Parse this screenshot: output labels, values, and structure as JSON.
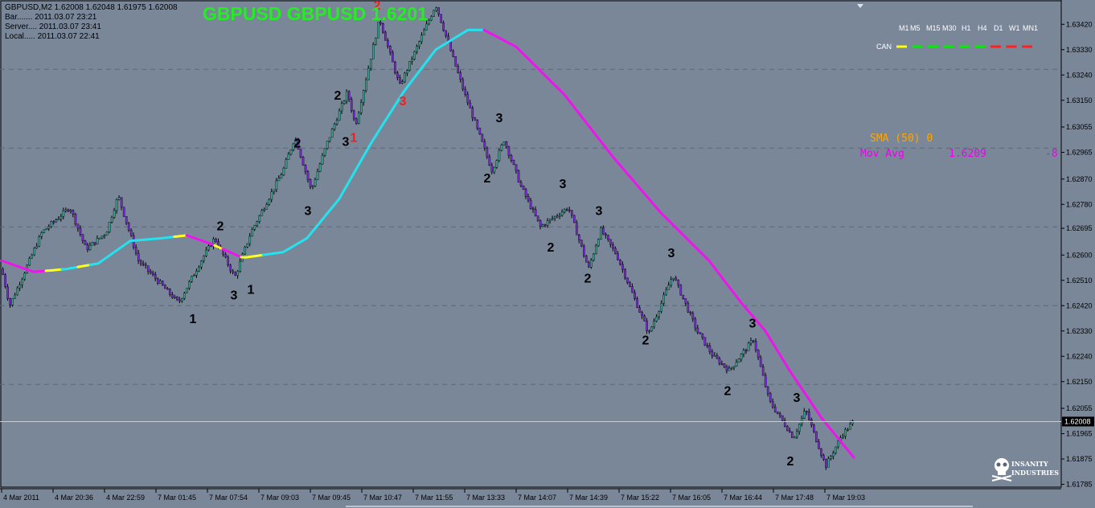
{
  "symbol_info": {
    "line1": "GBPUSD,M2  1.62008 1.62048 1.61975 1.62008",
    "line2": "Bar.......  2011.03.07 23:21",
    "line3": "Server....  2011.03.07 23:41",
    "line4": "Local.....  2011.03.07 22:41"
  },
  "chart_title": "GBPUSD GBPUSD 1.6201",
  "timeframes": [
    "M1",
    "M5",
    "M15",
    "M30",
    "H1",
    "H4",
    "D1",
    "W1",
    "MN1"
  ],
  "can_label": "CAN",
  "can_colors": [
    "#ffff00",
    "#00ee00",
    "#00ee00",
    "#00ee00",
    "#00ee00",
    "#00ee00",
    "#ff2020",
    "#ff2020",
    "#ff2020"
  ],
  "indicator_sma": {
    "text": "SMA (50) 0",
    "color": "#ffa500"
  },
  "indicator_mov": {
    "label": "Mov Avg",
    "value": "1.6209",
    "change": "-8",
    "color": "#ee00ee"
  },
  "current_price": "1.62008",
  "logo": {
    "line1": "INSANITY",
    "line2": "INDUSTRIES"
  },
  "colors": {
    "background": "#7a8799",
    "bull_body": "#3aa690",
    "bear_body": "#7c2ad8",
    "ma_rising": "#22e3ef",
    "ma_falling": "#ee14ee",
    "ma_flat": "#ffff22"
  },
  "chart_data": {
    "type": "candlestick",
    "y_ticks": [
      "1.63420",
      "1.63330",
      "1.63240",
      "1.63150",
      "1.63055",
      "1.62965",
      "1.62870",
      "1.62780",
      "1.62695",
      "1.62600",
      "1.62510",
      "1.62420",
      "1.62330",
      "1.62240",
      "1.62150",
      "1.62055",
      "1.61965",
      "1.61875",
      "1.61785"
    ],
    "ylim": [
      1.61775,
      1.63495
    ],
    "x_labels": [
      "4 Mar 2011",
      "4 Mar 20:36",
      "4 Mar 22:59",
      "7 Mar 01:45",
      "7 Mar 07:54",
      "7 Mar 09:03",
      "7 Mar 09:45",
      "7 Mar 10:47",
      "7 Mar 11:55",
      "7 Mar 13:33",
      "7 Mar 14:07",
      "7 Mar 14:39",
      "7 Mar 15:22",
      "7 Mar 16:05",
      "7 Mar 16:44",
      "7 Mar 17:48",
      "7 Mar 19:03"
    ],
    "price_path": [
      [
        0,
        1.6255
      ],
      [
        0.01,
        1.6242
      ],
      [
        0.05,
        1.6268
      ],
      [
        0.085,
        1.6277
      ],
      [
        0.105,
        1.6262
      ],
      [
        0.13,
        1.6268
      ],
      [
        0.145,
        1.6281
      ],
      [
        0.17,
        1.6258
      ],
      [
        0.22,
        1.6243
      ],
      [
        0.25,
        1.6259
      ],
      [
        0.265,
        1.6266
      ],
      [
        0.29,
        1.6252
      ],
      [
        0.31,
        1.6268
      ],
      [
        0.35,
        1.629
      ],
      [
        0.365,
        1.6302
      ],
      [
        0.385,
        1.6283
      ],
      [
        0.405,
        1.63
      ],
      [
        0.43,
        1.6318
      ],
      [
        0.44,
        1.6306
      ],
      [
        0.47,
        1.6344
      ],
      [
        0.495,
        1.632
      ],
      [
        0.54,
        1.6349
      ],
      [
        0.575,
        1.6318
      ],
      [
        0.61,
        1.629
      ],
      [
        0.625,
        1.6301
      ],
      [
        0.645,
        1.6285
      ],
      [
        0.67,
        1.627
      ],
      [
        0.705,
        1.6277
      ],
      [
        0.73,
        1.6255
      ],
      [
        0.745,
        1.6269
      ],
      [
        0.765,
        1.626
      ],
      [
        0.805,
        1.6232
      ],
      [
        0.835,
        1.6253
      ],
      [
        0.865,
        1.6233
      ],
      [
        0.885,
        1.6224
      ],
      [
        0.905,
        1.6219
      ],
      [
        0.935,
        1.623
      ],
      [
        0.955,
        1.6208
      ],
      [
        0.985,
        1.6195
      ],
      [
        1.0,
        1.6205
      ],
      [
        1.025,
        1.6185
      ],
      [
        1.045,
        1.6196
      ],
      [
        1.06,
        1.6201
      ]
    ],
    "moving_average": {
      "name": "Mov Avg",
      "points": [
        [
          0,
          1.6258
        ],
        [
          0.04,
          1.6254
        ],
        [
          0.08,
          1.6255
        ],
        [
          0.12,
          1.6257
        ],
        [
          0.16,
          1.6265
        ],
        [
          0.2,
          1.6266
        ],
        [
          0.23,
          1.6267
        ],
        [
          0.26,
          1.6264
        ],
        [
          0.3,
          1.6259
        ],
        [
          0.35,
          1.6261
        ],
        [
          0.38,
          1.6266
        ],
        [
          0.42,
          1.628
        ],
        [
          0.46,
          1.63
        ],
        [
          0.5,
          1.6318
        ],
        [
          0.54,
          1.6333
        ],
        [
          0.58,
          1.634
        ],
        [
          0.6,
          1.634
        ],
        [
          0.64,
          1.6334
        ],
        [
          0.7,
          1.6317
        ],
        [
          0.76,
          1.6295
        ],
        [
          0.82,
          1.6275
        ],
        [
          0.88,
          1.6258
        ],
        [
          0.92,
          1.6243
        ],
        [
          0.95,
          1.6233
        ],
        [
          0.98,
          1.6219
        ],
        [
          1.02,
          1.6202
        ],
        [
          1.06,
          1.6188
        ]
      ],
      "color_segments": [
        {
          "from": 0,
          "to": 0.055,
          "state": "falling"
        },
        {
          "from": 0.055,
          "to": 0.075,
          "state": "flat"
        },
        {
          "from": 0.075,
          "to": 0.095,
          "state": "rising"
        },
        {
          "from": 0.095,
          "to": 0.11,
          "state": "flat"
        },
        {
          "from": 0.11,
          "to": 0.215,
          "state": "rising"
        },
        {
          "from": 0.215,
          "to": 0.23,
          "state": "flat"
        },
        {
          "from": 0.23,
          "to": 0.265,
          "state": "falling"
        },
        {
          "from": 0.265,
          "to": 0.275,
          "state": "flat"
        },
        {
          "from": 0.275,
          "to": 0.298,
          "state": "falling"
        },
        {
          "from": 0.298,
          "to": 0.325,
          "state": "flat"
        },
        {
          "from": 0.325,
          "to": 0.6,
          "state": "rising"
        },
        {
          "from": 0.6,
          "to": 1.06,
          "state": "falling"
        }
      ]
    },
    "wave_labels": [
      {
        "text": "1",
        "t": 0.238,
        "price": 1.62415,
        "pos": "below",
        "color": "#000000"
      },
      {
        "text": "2",
        "t": 0.272,
        "price": 1.62665,
        "pos": "above",
        "color": "#000000"
      },
      {
        "text": "3",
        "t": 0.289,
        "price": 1.625,
        "pos": "below",
        "color": "#000000"
      },
      {
        "text": "1",
        "t": 0.31,
        "price": 1.6252,
        "pos": "below",
        "color": "#000000"
      },
      {
        "text": "2",
        "t": 0.368,
        "price": 1.6296,
        "pos": "above",
        "color": "#000000"
      },
      {
        "text": "3",
        "t": 0.381,
        "price": 1.628,
        "pos": "below",
        "color": "#000000"
      },
      {
        "text": "2",
        "t": 0.418,
        "price": 1.6313,
        "pos": "above",
        "color": "#000000"
      },
      {
        "text": "3",
        "t": 0.428,
        "price": 1.63045,
        "pos": "below",
        "color": "#000000"
      },
      {
        "text": "1",
        "t": 0.438,
        "price": 1.6306,
        "pos": "below",
        "color": "#ee2020"
      },
      {
        "text": "2",
        "t": 0.467,
        "price": 1.6345,
        "pos": "above",
        "color": "#ee2020"
      },
      {
        "text": "3",
        "t": 0.499,
        "price": 1.6319,
        "pos": "below",
        "color": "#ee2020"
      },
      {
        "text": "1",
        "t": 0.538,
        "price": 1.635,
        "pos": "above",
        "color": "#000000"
      },
      {
        "text": "2",
        "t": 0.604,
        "price": 1.62915,
        "pos": "below",
        "color": "#000000"
      },
      {
        "text": "3",
        "t": 0.619,
        "price": 1.6305,
        "pos": "above",
        "color": "#000000"
      },
      {
        "text": "2",
        "t": 0.683,
        "price": 1.6267,
        "pos": "below",
        "color": "#000000"
      },
      {
        "text": "3",
        "t": 0.698,
        "price": 1.62815,
        "pos": "above",
        "color": "#000000"
      },
      {
        "text": "2",
        "t": 0.729,
        "price": 1.6256,
        "pos": "below",
        "color": "#000000"
      },
      {
        "text": "3",
        "t": 0.743,
        "price": 1.6272,
        "pos": "above",
        "color": "#000000"
      },
      {
        "text": "2",
        "t": 0.801,
        "price": 1.6234,
        "pos": "below",
        "color": "#000000"
      },
      {
        "text": "3",
        "t": 0.833,
        "price": 1.6257,
        "pos": "above",
        "color": "#000000"
      },
      {
        "text": "2",
        "t": 0.903,
        "price": 1.6216,
        "pos": "below",
        "color": "#000000"
      },
      {
        "text": "3",
        "t": 0.934,
        "price": 1.6232,
        "pos": "above",
        "color": "#000000"
      },
      {
        "text": "3",
        "t": 0.989,
        "price": 1.62055,
        "pos": "above",
        "color": "#000000"
      },
      {
        "text": "2",
        "t": 0.981,
        "price": 1.6191,
        "pos": "below",
        "color": "#000000"
      }
    ]
  }
}
